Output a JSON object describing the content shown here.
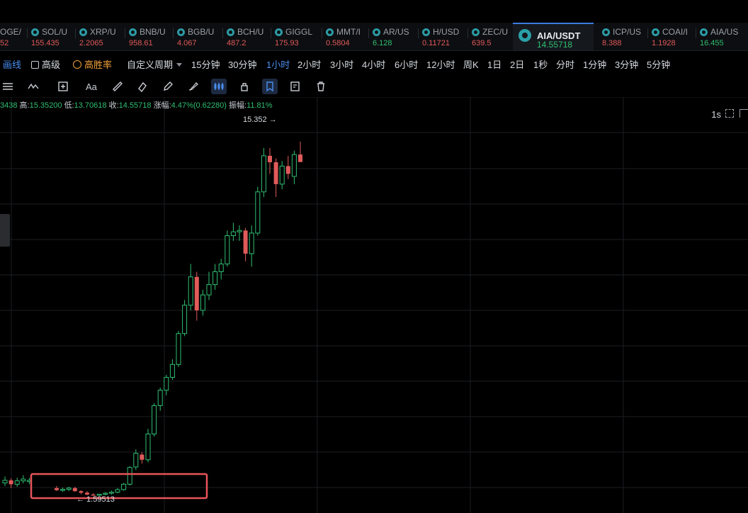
{
  "tickers": [
    {
      "symbol": "OGE/",
      "price": "52",
      "price_color": "red"
    },
    {
      "symbol": "SOL/U",
      "price": "155.435",
      "price_color": "red"
    },
    {
      "symbol": "XRP/U",
      "price": "2.2065",
      "price_color": "red"
    },
    {
      "symbol": "BNB/U",
      "price": "958.61",
      "price_color": "red"
    },
    {
      "symbol": "BGB/U",
      "price": "4.067",
      "price_color": "red"
    },
    {
      "symbol": "BCH/U",
      "price": "487.2",
      "price_color": "red"
    },
    {
      "symbol": "GIGGL",
      "price": "175.93",
      "price_color": "red"
    },
    {
      "symbol": "MMT/I",
      "price": "0.5804",
      "price_color": "red"
    },
    {
      "symbol": "AR/US",
      "price": "6.128",
      "price_color": "green"
    },
    {
      "symbol": "H/USD",
      "price": "0.11721",
      "price_color": "red"
    },
    {
      "symbol": "ZEC/U",
      "price": "639.5",
      "price_color": "red"
    },
    {
      "symbol": "AIA/USDT",
      "price": "14.55718",
      "price_color": "green",
      "active": true
    },
    {
      "symbol": "ICP/US",
      "price": "8.388",
      "price_color": "red"
    },
    {
      "symbol": "COAI/I",
      "price": "1.1928",
      "price_color": "red"
    },
    {
      "symbol": "AIA/US",
      "price": "16.455",
      "price_color": "green"
    }
  ],
  "period_bar": {
    "draw_label": "画线",
    "advanced_label": "高级",
    "winrate_label": "高胜率",
    "custom_period_label": "自定义周期",
    "periods": [
      "15分钟",
      "30分钟",
      "1小时",
      "2小时",
      "3小时",
      "4小时",
      "6小时",
      "12小时",
      "周K",
      "1日",
      "2日",
      "1秒",
      "分时",
      "1分钟",
      "3分钟",
      "5分钟"
    ],
    "active_period": "1小时",
    "right_label": "1s"
  },
  "ohlc": {
    "open_fragment": "3438",
    "high_label": "高:",
    "high_value": "15.35200",
    "low_label": "低:",
    "low_value": "13.70618",
    "close_label": "收:",
    "close_value": "14.55718",
    "change_label": "涨幅:",
    "change_value": "4.47%(0.62280)",
    "amplitude_label": "振幅:",
    "amplitude_value": "11.81%"
  },
  "chart_data": {
    "type": "candlestick",
    "high_marker": "15.352 →",
    "low_marker": "← 1.59513",
    "up_color": "#2fbf71",
    "down_color": "#e05a5a",
    "highlight_color": "#e8555a",
    "price_range": [
      1.4,
      16.2
    ],
    "candles": [
      {
        "o": 2.1,
        "h": 2.35,
        "l": 1.98,
        "c": 2.2
      },
      {
        "o": 2.2,
        "h": 2.28,
        "l": 1.9,
        "c": 2.05
      },
      {
        "o": 2.05,
        "h": 2.3,
        "l": 1.95,
        "c": 2.18
      },
      {
        "o": 2.18,
        "h": 2.4,
        "l": 2.08,
        "c": 2.25
      },
      {
        "o": 2.15,
        "h": 2.3,
        "l": 2.05,
        "c": 2.2
      },
      {
        "o": 1.9,
        "h": 1.98,
        "l": 1.78,
        "c": 1.82
      },
      {
        "o": 1.82,
        "h": 1.92,
        "l": 1.75,
        "c": 1.85
      },
      {
        "o": 1.85,
        "h": 1.95,
        "l": 1.78,
        "c": 1.9
      },
      {
        "o": 1.9,
        "h": 1.95,
        "l": 1.75,
        "c": 1.78
      },
      {
        "o": 1.78,
        "h": 1.82,
        "l": 1.66,
        "c": 1.72
      },
      {
        "o": 1.72,
        "h": 1.78,
        "l": 1.62,
        "c": 1.65
      },
      {
        "o": 1.65,
        "h": 1.7,
        "l": 1.6,
        "c": 1.62
      },
      {
        "o": 1.62,
        "h": 1.68,
        "l": 1.595,
        "c": 1.66
      },
      {
        "o": 1.66,
        "h": 1.75,
        "l": 1.62,
        "c": 1.7
      },
      {
        "o": 1.7,
        "h": 1.8,
        "l": 1.64,
        "c": 1.74
      },
      {
        "o": 1.74,
        "h": 1.9,
        "l": 1.7,
        "c": 1.84
      },
      {
        "o": 1.84,
        "h": 2.1,
        "l": 1.8,
        "c": 2.05
      },
      {
        "o": 2.05,
        "h": 2.75,
        "l": 2.0,
        "c": 2.7
      },
      {
        "o": 2.72,
        "h": 3.4,
        "l": 2.6,
        "c": 3.25
      },
      {
        "o": 3.2,
        "h": 3.3,
        "l": 2.85,
        "c": 3.0
      },
      {
        "o": 3.0,
        "h": 4.2,
        "l": 2.9,
        "c": 4.0
      },
      {
        "o": 4.0,
        "h": 5.2,
        "l": 3.9,
        "c": 5.1
      },
      {
        "o": 5.1,
        "h": 5.8,
        "l": 4.9,
        "c": 5.7
      },
      {
        "o": 5.7,
        "h": 6.3,
        "l": 5.5,
        "c": 6.2
      },
      {
        "o": 6.2,
        "h": 6.9,
        "l": 6.1,
        "c": 6.7
      },
      {
        "o": 6.7,
        "h": 8.0,
        "l": 6.6,
        "c": 7.9
      },
      {
        "o": 7.9,
        "h": 9.2,
        "l": 7.8,
        "c": 9.0
      },
      {
        "o": 9.0,
        "h": 10.6,
        "l": 8.8,
        "c": 10.1
      },
      {
        "o": 10.1,
        "h": 10.3,
        "l": 8.4,
        "c": 8.8
      },
      {
        "o": 8.8,
        "h": 9.6,
        "l": 8.6,
        "c": 9.4
      },
      {
        "o": 9.4,
        "h": 10.3,
        "l": 9.2,
        "c": 9.8
      },
      {
        "o": 9.8,
        "h": 10.6,
        "l": 9.6,
        "c": 10.3
      },
      {
        "o": 10.3,
        "h": 10.8,
        "l": 10.0,
        "c": 10.6
      },
      {
        "o": 10.6,
        "h": 11.9,
        "l": 10.5,
        "c": 11.7
      },
      {
        "o": 11.7,
        "h": 12.2,
        "l": 11.5,
        "c": 11.85
      },
      {
        "o": 11.85,
        "h": 12.1,
        "l": 11.5,
        "c": 11.9
      },
      {
        "o": 11.9,
        "h": 12.0,
        "l": 10.7,
        "c": 11.0
      },
      {
        "o": 11.0,
        "h": 12.1,
        "l": 10.5,
        "c": 11.8
      },
      {
        "o": 11.8,
        "h": 13.6,
        "l": 11.7,
        "c": 13.4
      },
      {
        "o": 13.4,
        "h": 15.1,
        "l": 13.2,
        "c": 14.8
      },
      {
        "o": 14.8,
        "h": 15.1,
        "l": 14.1,
        "c": 14.55
      },
      {
        "o": 14.55,
        "h": 14.7,
        "l": 13.2,
        "c": 13.7
      },
      {
        "o": 13.7,
        "h": 14.6,
        "l": 13.5,
        "c": 14.4
      },
      {
        "o": 14.4,
        "h": 14.8,
        "l": 13.9,
        "c": 14.1
      },
      {
        "o": 14.0,
        "h": 15.0,
        "l": 13.7,
        "c": 14.85
      },
      {
        "o": 14.85,
        "h": 15.352,
        "l": 14.6,
        "c": 14.557
      }
    ]
  }
}
